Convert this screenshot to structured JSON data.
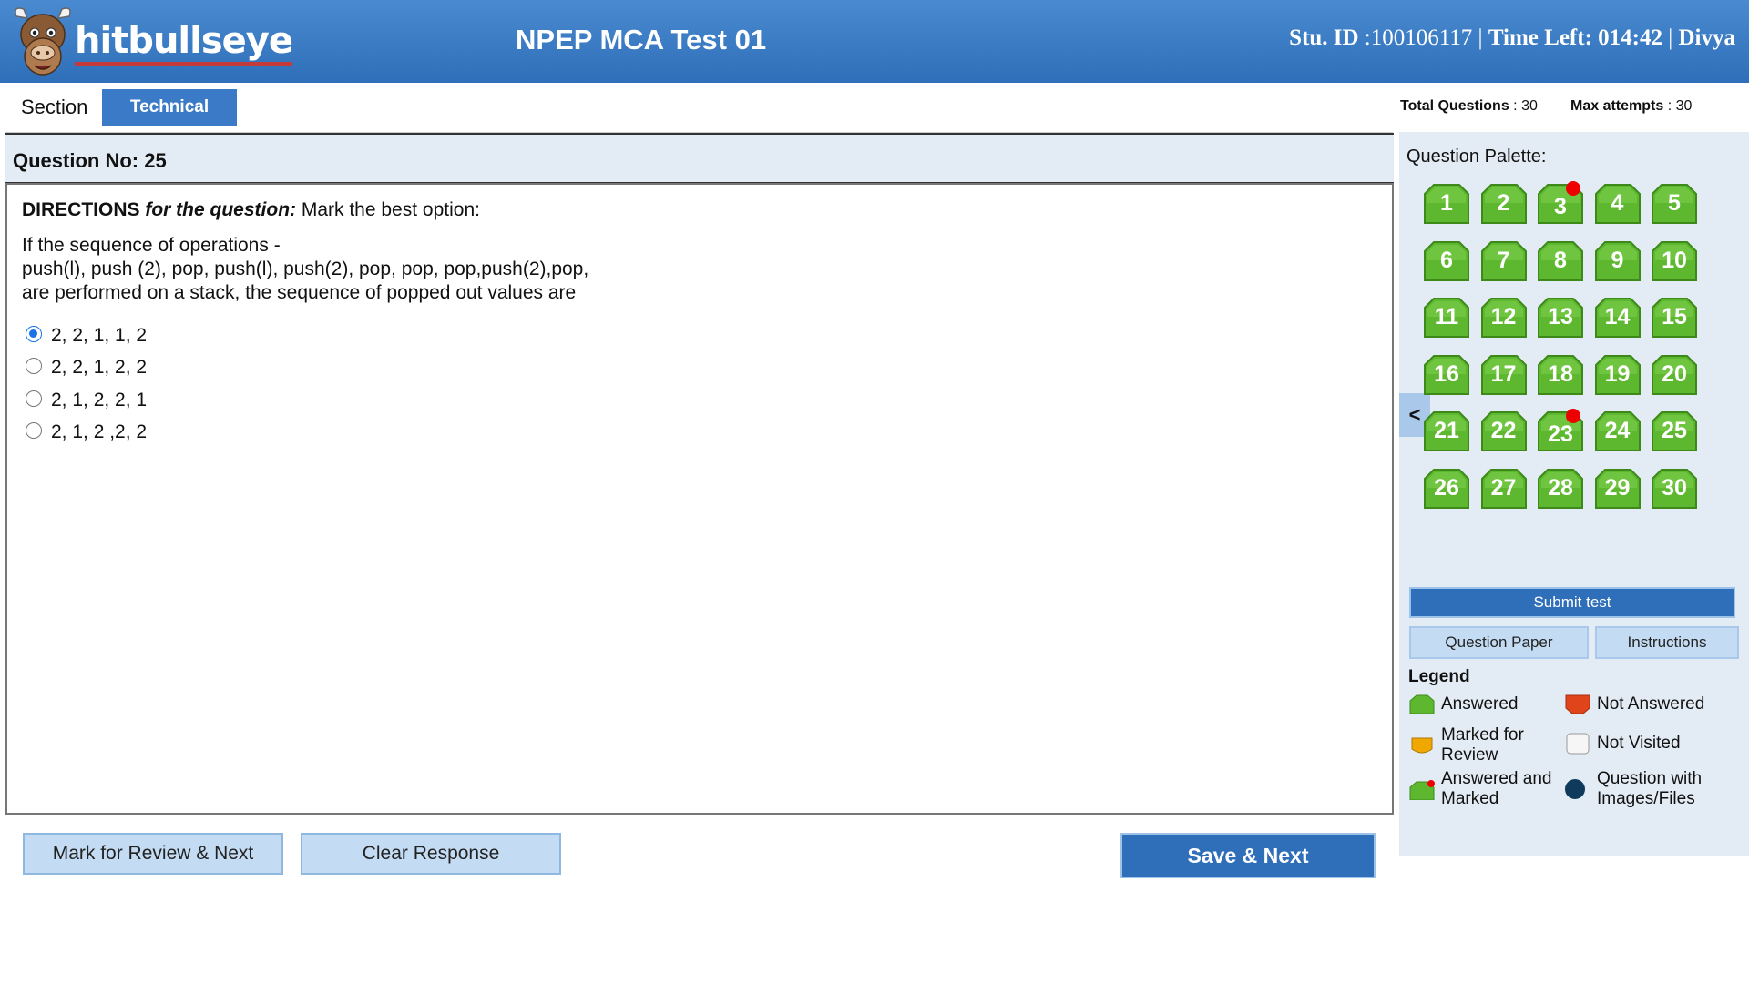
{
  "header": {
    "logo_text": "hitbullseye",
    "title": "NPEP MCA Test 01",
    "stu_id_label": "Stu. ID",
    "stu_id_value": " :100106117",
    "time_left_label": "Time Left: 014:42",
    "user_name": "Divya",
    "separator": "|"
  },
  "section": {
    "label": "Section",
    "active_tab": "Technical",
    "total_questions_label": "Total Questions",
    "total_questions_value": ": 30",
    "max_attempts_label": "Max attempts",
    "max_attempts_value": ": 30"
  },
  "question": {
    "number_label": "Question No: 25",
    "directions_bold": "DIRECTIONS",
    "directions_italic": "for the question:",
    "directions_text": " Mark the best option:",
    "text_lines": [
      "If the sequence of operations -",
      "push(l), push (2), pop, push(l), push(2), pop, pop, pop,push(2),pop,",
      "are performed on a stack, the sequence of popped out values are"
    ],
    "options": [
      "2, 2, 1, 1, 2",
      "2, 2, 1, 2, 2",
      "2, 1, 2, 2, 1",
      "2, 1, 2 ,2, 2"
    ],
    "selected_option": 0
  },
  "footer": {
    "mark_review": "Mark for Review & Next",
    "clear": "Clear Response",
    "save_next": "Save & Next"
  },
  "palette": {
    "title": "Question Palette:",
    "collapse": "<",
    "questions": [
      "1",
      "2",
      "3",
      "4",
      "5",
      "6",
      "7",
      "8",
      "9",
      "10",
      "11",
      "12",
      "13",
      "14",
      "15",
      "16",
      "17",
      "18",
      "19",
      "20",
      "21",
      "22",
      "23",
      "24",
      "25",
      "26",
      "27",
      "28",
      "29",
      "30"
    ],
    "marked": [
      "3",
      "23"
    ],
    "submit": "Submit test",
    "question_paper": "Question Paper",
    "instructions": "Instructions",
    "legend_title": "Legend",
    "legend": {
      "answered": "Answered",
      "not_answered": "Not Answered",
      "marked_review": "Marked for Review",
      "not_visited": "Not Visited",
      "answered_marked": "Answered and Marked",
      "images": "Question with Images/Files"
    }
  },
  "colors": {
    "header_blue": "#2f6fb9",
    "answered_green": "#5eb82f",
    "not_answered_red": "#e0441b",
    "marked_orange": "#f0a800",
    "images_navy": "#0e3a5c",
    "marked_dot": "#e00000"
  }
}
